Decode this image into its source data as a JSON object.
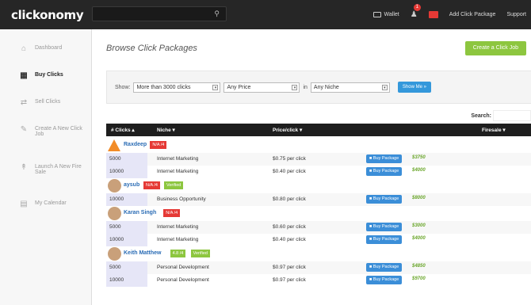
{
  "app": {
    "logo": "clickonomy"
  },
  "topnav": {
    "wallet": "Wallet",
    "notif_count": "1",
    "add_package": "Add Click Package",
    "support": "Support"
  },
  "sidebar": {
    "items": [
      {
        "label": "Dashboard",
        "icon": "home-icon"
      },
      {
        "label": "Buy Clicks",
        "icon": "grid-icon",
        "active": true
      },
      {
        "label": "Sell Clicks",
        "icon": "shuffle-icon"
      },
      {
        "label": "Create A New Click Job",
        "icon": "edit-icon"
      },
      {
        "label": "Launch A New Fire Sale",
        "icon": "rocket-icon"
      },
      {
        "label": "My Calendar",
        "icon": "calendar-icon"
      }
    ]
  },
  "main": {
    "title": "Browse Click Packages",
    "create_button": "Create a Click Job",
    "filter": {
      "show_label": "Show:",
      "clicks_value": "More than 3000 clicks",
      "price_value": "Any Price",
      "in_label": "in",
      "niche_value": "Any Niche",
      "button": "Show Me »"
    },
    "search_label": "Search:",
    "columns": [
      "# Clicks ▴",
      "Niche ▾",
      "Price/click ▾",
      "Firesale ▾"
    ],
    "buy_label": "■ Buy Package"
  },
  "sellers": [
    {
      "name": "Raxdeep",
      "tags": [
        {
          "text": "N/A /4",
          "color": "red"
        }
      ],
      "avatar": "cone",
      "rows": [
        {
          "clicks": "5000",
          "niche": "Internet Marketing",
          "price": "$0.75 per click",
          "fire": "$3750"
        },
        {
          "clicks": "10000",
          "niche": "Internet Marketing",
          "price": "$0.40 per click",
          "fire": "$4000"
        }
      ]
    },
    {
      "name": "aysub",
      "tags": [
        {
          "text": "N/A /4",
          "color": "red"
        },
        {
          "text": "Verified",
          "color": "green"
        }
      ],
      "avatar": "photo",
      "rows": [
        {
          "clicks": "10000",
          "niche": "Business Opportunity",
          "price": "$0.80 per click",
          "fire": "$8000"
        }
      ]
    },
    {
      "name": "Karan Singh",
      "tags": [
        {
          "text": "N/A /4",
          "color": "red"
        }
      ],
      "avatar": "photo",
      "rows": [
        {
          "clicks": "5000",
          "niche": "Internet Marketing",
          "price": "$0.60 per click",
          "fire": "$3000"
        },
        {
          "clicks": "10000",
          "niche": "Internet Marketing",
          "price": "$0.40 per click",
          "fire": "$4000"
        }
      ]
    },
    {
      "name": "Keith Matthew",
      "tags": [
        {
          "text": "4.8 /4",
          "color": "green"
        },
        {
          "text": "Verified",
          "color": "green"
        }
      ],
      "avatar": "photo",
      "rows": [
        {
          "clicks": "5000",
          "niche": "Personal Development",
          "price": "$0.97 per click",
          "fire": "$4850"
        },
        {
          "clicks": "10000",
          "niche": "Personal Development",
          "price": "$0.97 per click",
          "fire": "$9700"
        }
      ]
    }
  ]
}
